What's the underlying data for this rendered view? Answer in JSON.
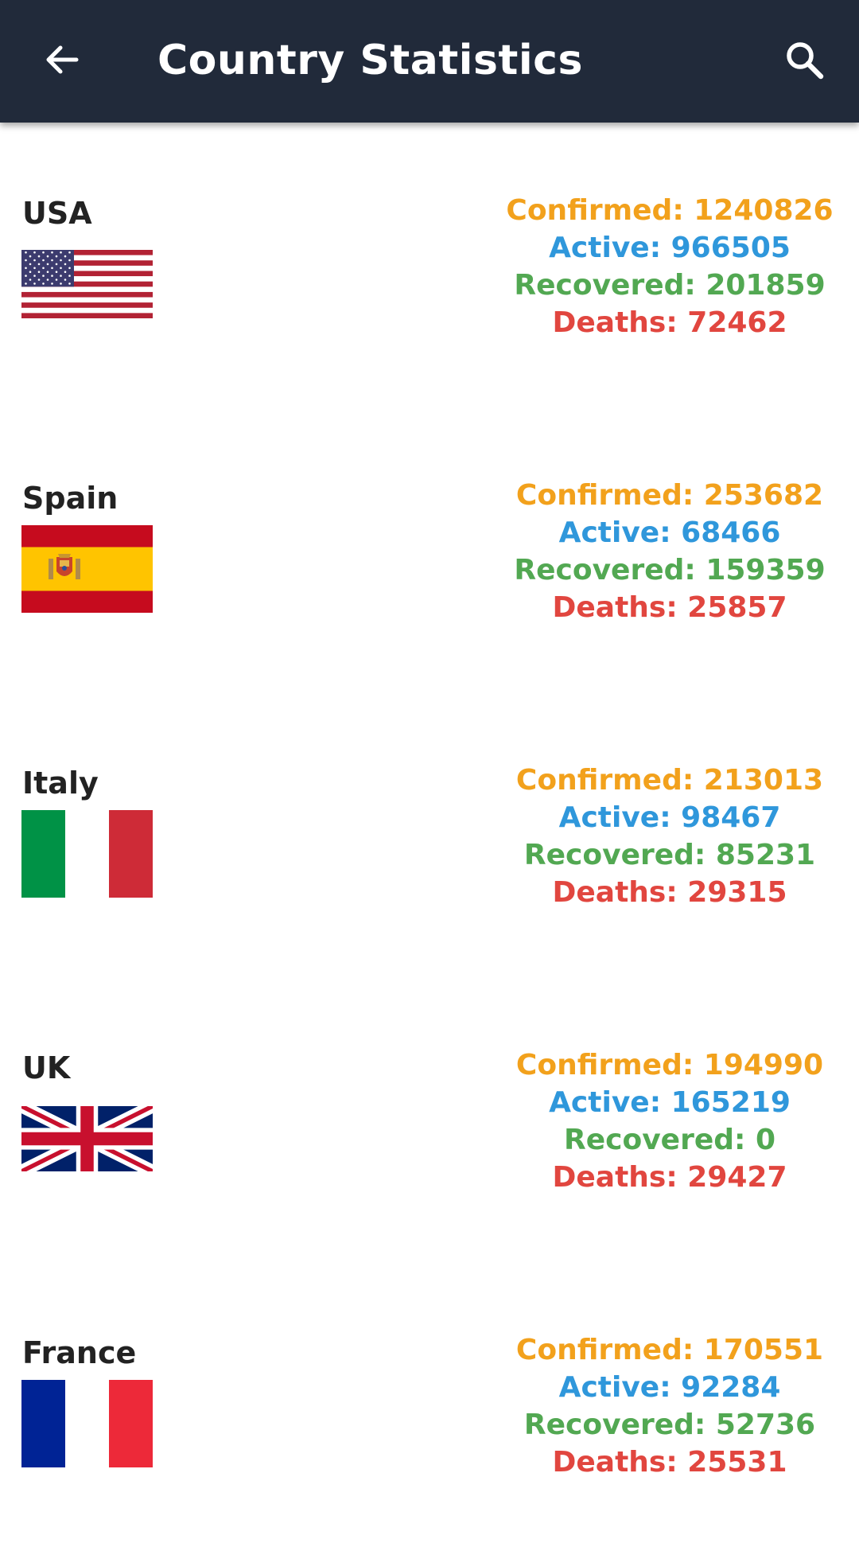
{
  "appbar": {
    "title": "Country Statistics",
    "back_icon": "arrow-left-icon",
    "search_icon": "search-icon"
  },
  "colors": {
    "appbar_bg": "#212a3a",
    "confirmed": "#f2a11c",
    "active": "#2f97db",
    "recovered": "#52a852",
    "deaths": "#e1463f"
  },
  "countries": [
    {
      "name": "USA",
      "flag": "usa-flag",
      "confirmed": "Confirmed: 1240826",
      "active": "Active: 966505",
      "recovered": "Recovered: 201859",
      "deaths": "Deaths: 72462"
    },
    {
      "name": "Spain",
      "flag": "spain-flag",
      "confirmed": "Confirmed: 253682",
      "active": "Active: 68466",
      "recovered": "Recovered: 159359",
      "deaths": "Deaths: 25857"
    },
    {
      "name": "Italy",
      "flag": "italy-flag",
      "confirmed": "Confirmed: 213013",
      "active": "Active: 98467",
      "recovered": "Recovered: 85231",
      "deaths": "Deaths: 29315"
    },
    {
      "name": "UK",
      "flag": "uk-flag",
      "confirmed": "Confirmed: 194990",
      "active": "Active: 165219",
      "recovered": "Recovered: 0",
      "deaths": "Deaths: 29427"
    },
    {
      "name": "France",
      "flag": "france-flag",
      "confirmed": "Confirmed: 170551",
      "active": "Active: 92284",
      "recovered": "Recovered: 52736",
      "deaths": "Deaths: 25531"
    }
  ]
}
